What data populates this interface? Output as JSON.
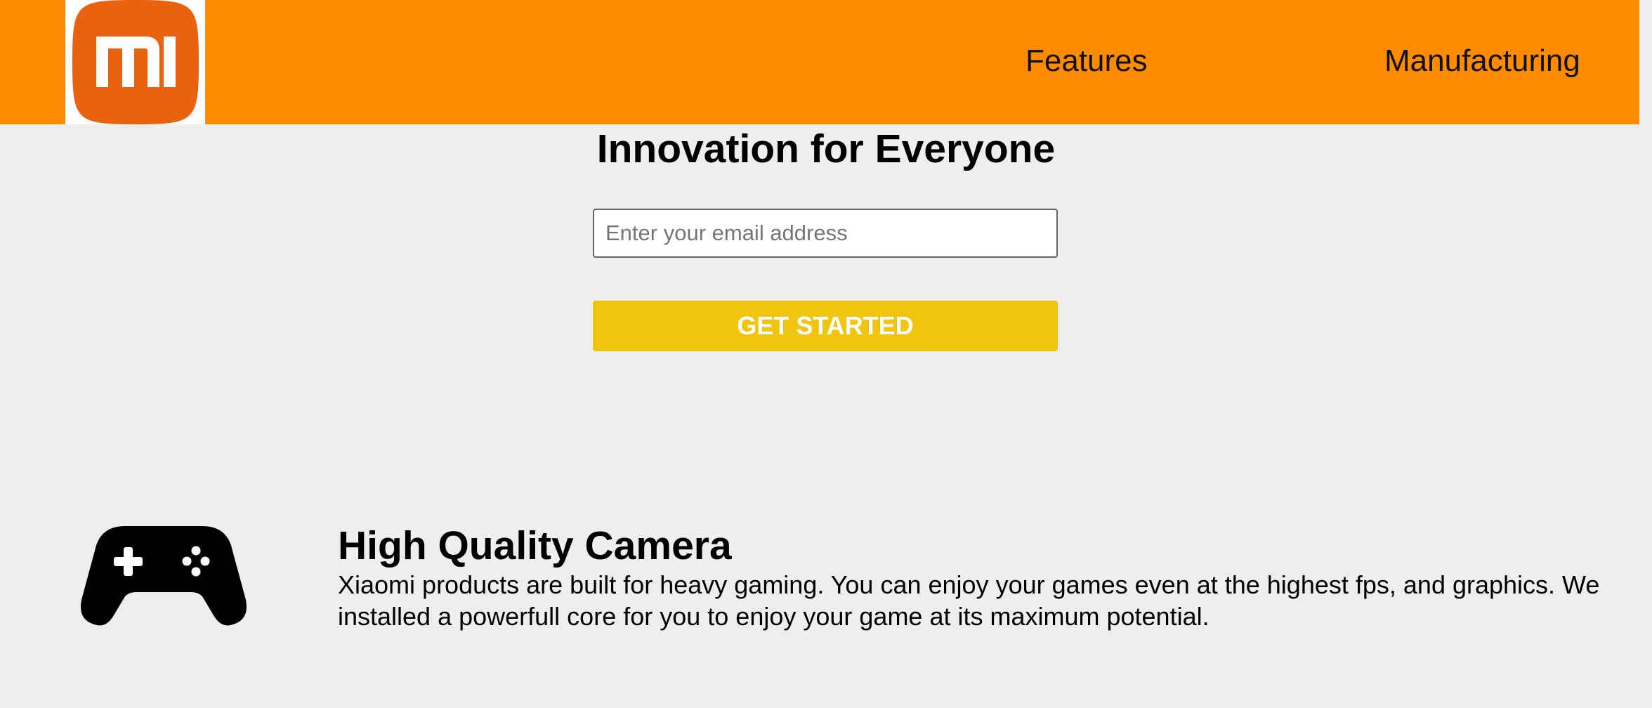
{
  "header": {
    "logo_text": "mi",
    "brand_color": "#ff8c00",
    "logo_color": "#e8620f",
    "nav": [
      {
        "label": "Features"
      },
      {
        "label": "Manufacturing"
      }
    ]
  },
  "hero": {
    "title": "Innovation for Everyone",
    "email_placeholder": "Enter your email address",
    "email_value": "",
    "cta_label": "GET STARTED",
    "cta_color": "#f1c40f"
  },
  "features": [
    {
      "icon": "gamepad-icon",
      "title": "High Quality Camera",
      "description": "Xiaomi products are built for heavy gaming. You can enjoy your games even at the highest fps, and graphics. We installed a powerfull core for you to enjoy your game at its maximum potential."
    }
  ]
}
